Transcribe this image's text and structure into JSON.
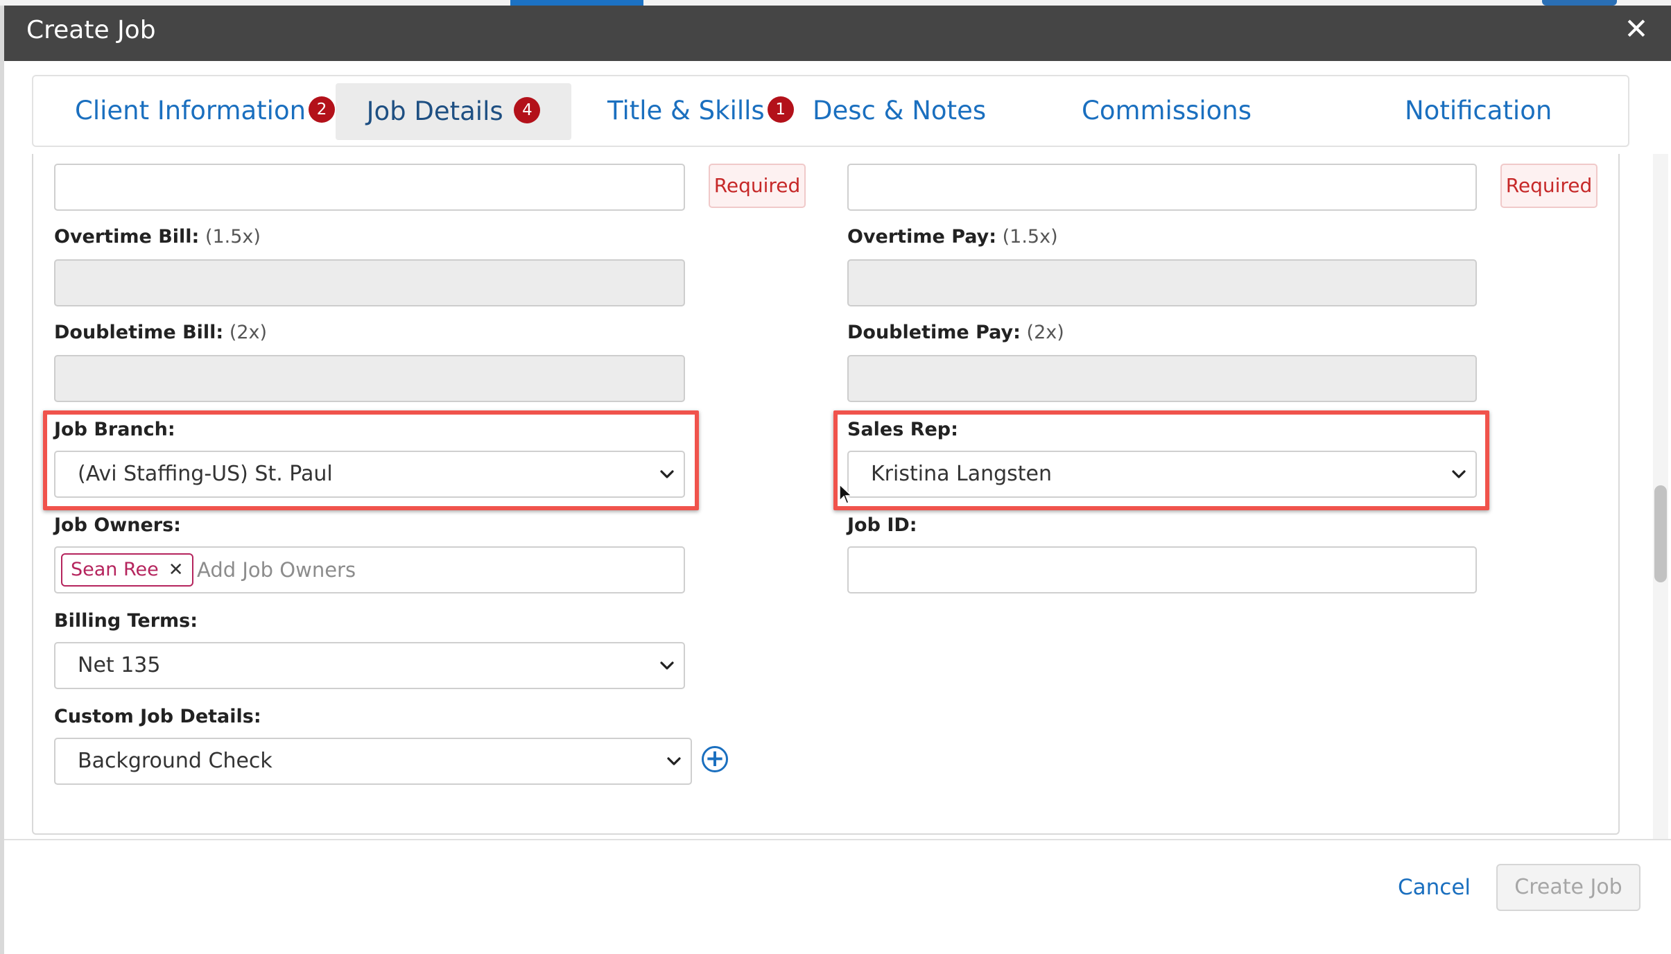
{
  "modal": {
    "title": "Create Job",
    "close_glyph": "✕"
  },
  "tabs": [
    {
      "label": "Client Information",
      "badge": "2"
    },
    {
      "label": "Job Details",
      "badge": "4"
    },
    {
      "label": "Title & Skills",
      "badge": "1"
    },
    {
      "label": "Desc & Notes"
    },
    {
      "label": "Commissions"
    },
    {
      "label": "Notification"
    }
  ],
  "form": {
    "required_text": "Required",
    "overtime_bill": {
      "label": "Overtime Bill:",
      "hint": "(1.5x)"
    },
    "overtime_pay": {
      "label": "Overtime Pay:",
      "hint": "(1.5x)"
    },
    "doubletime_bill": {
      "label": "Doubletime Bill:",
      "hint": "(2x)"
    },
    "doubletime_pay": {
      "label": "Doubletime Pay:",
      "hint": "(2x)"
    },
    "job_branch": {
      "label": "Job Branch:",
      "value": "(Avi Staffing-US) St. Paul"
    },
    "sales_rep": {
      "label": "Sales Rep:",
      "value": "Kristina Langsten"
    },
    "job_owners": {
      "label": "Job Owners:",
      "chip": "Sean Ree",
      "placeholder": "Add Job Owners"
    },
    "job_id": {
      "label": "Job ID:"
    },
    "billing_terms": {
      "label": "Billing Terms:",
      "value": "Net 135"
    },
    "custom_job_details": {
      "label": "Custom Job Details:",
      "value": "Background Check"
    }
  },
  "footer": {
    "cancel_label": "Cancel",
    "create_label": "Create Job"
  },
  "colors": {
    "header": "#454545",
    "link": "#1a6fbf",
    "badge": "#b3111a",
    "highlight": "#f0534c",
    "chip": "#b5245d"
  }
}
